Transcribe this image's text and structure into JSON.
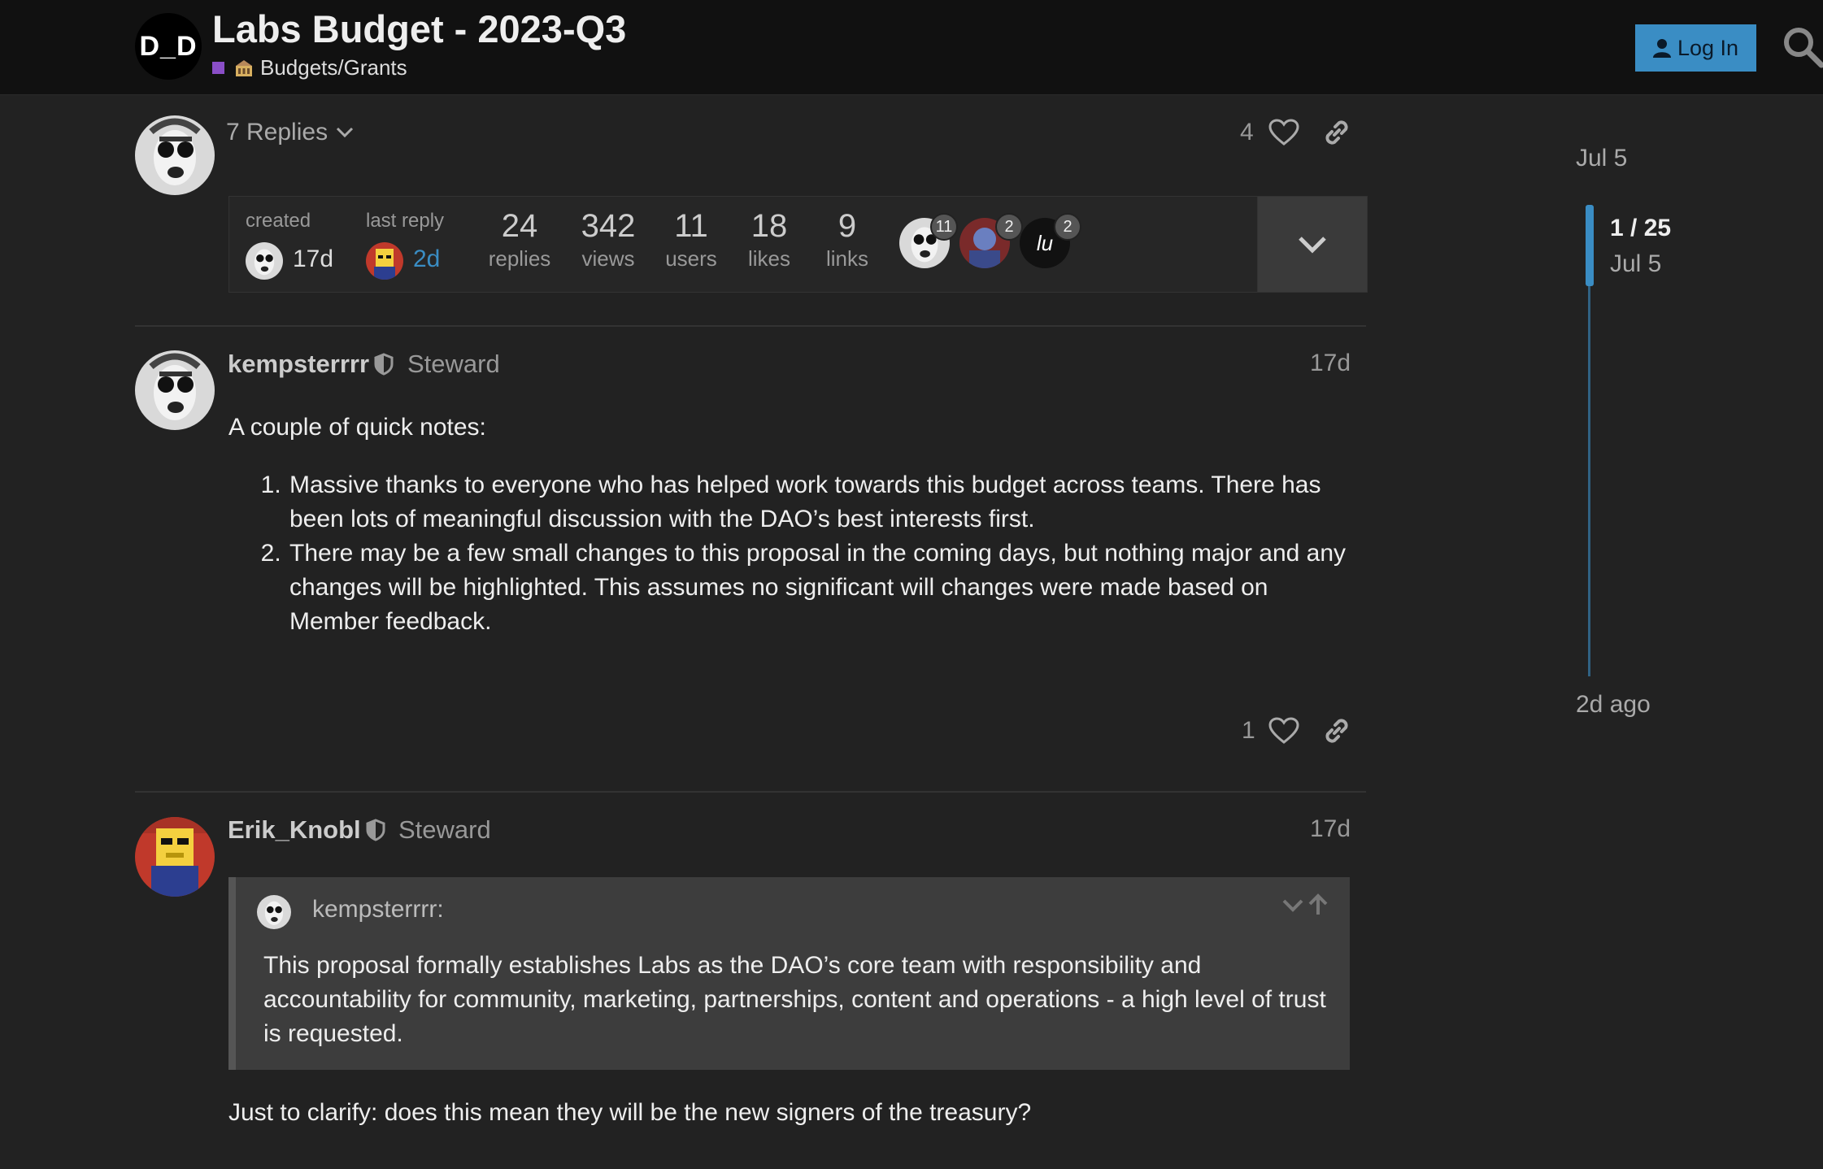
{
  "header": {
    "logo_text": "D_D",
    "title": "Labs Budget - 2023-Q3",
    "category": "Budgets/Grants",
    "category_color": "#8a4ec7",
    "login_label": "Log In",
    "accent": "#3a8dc4"
  },
  "first_post": {
    "replies_label": "7 Replies",
    "likes": "4"
  },
  "topic_map": {
    "created_label": "created",
    "created_value": "17d",
    "last_reply_label": "last reply",
    "last_reply_value": "2d",
    "stats": [
      {
        "num": "24",
        "label": "replies"
      },
      {
        "num": "342",
        "label": "views"
      },
      {
        "num": "11",
        "label": "users"
      },
      {
        "num": "18",
        "label": "likes"
      },
      {
        "num": "9",
        "label": "links"
      }
    ],
    "participants": [
      {
        "count": "11"
      },
      {
        "count": "2"
      },
      {
        "initials": "lu",
        "count": "2"
      }
    ]
  },
  "posts": [
    {
      "username": "kempsterrrr",
      "title": "Steward",
      "date": "17d",
      "intro": "A couple of quick notes:",
      "items": [
        "Massive thanks to everyone who has helped work towards this budget across teams. There has been lots of meaningful discussion with the DAO’s best interests first.",
        "There may be a few small changes to this proposal in the coming days, but nothing major and any changes will be highlighted. This assumes no significant will changes were made based on Member feedback."
      ],
      "likes": "1"
    },
    {
      "username": "Erik_Knobl",
      "title": "Steward",
      "date": "17d",
      "quote_user": "kempsterrrr:",
      "quote_text": "This proposal formally establishes Labs as the DAO’s core team with responsibility and accountability for community, marketing, partnerships, content and operations - a high level of trust is requested.",
      "body": "Just to clarify: does this mean they will be the new signers of the treasury?"
    }
  ],
  "timeline": {
    "start": "Jul 5",
    "position": "1 / 25",
    "position_date": "Jul 5",
    "end": "2d ago"
  }
}
